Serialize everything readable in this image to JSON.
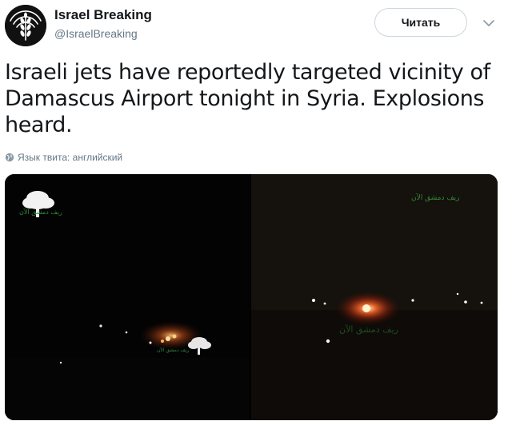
{
  "author": {
    "display_name": "Israel Breaking",
    "handle": "@IsraelBreaking",
    "avatar_icon": "ear-of-wheat-icon"
  },
  "header": {
    "follow_label": "Читать",
    "more_icon": "chevron-down-icon"
  },
  "tweet": {
    "text": "Israeli jets have reportedly targeted vicinity of Damascus Airport tonight in Syria. Explosions heard.",
    "language_label": "Язык твита: английский",
    "language_icon": "globe-icon"
  },
  "media": {
    "photos": [
      {
        "description_icon": "night-explosion-photo",
        "watermark_icon": "tree-watermark-icon",
        "watermark_text": "ريف دمشق الآن"
      },
      {
        "description_icon": "night-explosion-photo",
        "watermark_text": "ريف دمشق الآن"
      }
    ]
  },
  "colors": {
    "text_primary": "#14171a",
    "text_secondary": "#657786",
    "border": "#ccd6dd",
    "watermark_green": "#2f8a3a"
  }
}
